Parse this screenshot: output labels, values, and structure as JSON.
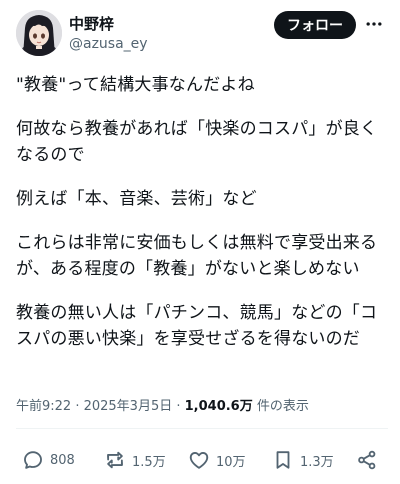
{
  "author": {
    "display_name": "中野梓",
    "handle": "@azusa_ey"
  },
  "follow_button": "フォロー",
  "tweet": {
    "paragraphs": [
      "\"教養\"って結構大事なんだよね",
      "何故なら教養があれば「快楽のコスパ」が良くなるので",
      "例えば「本、音楽、芸術」など",
      "これらは非常に安価もしくは無料で享受出来るが、ある程度の「教養」がないと楽しめない",
      "教養の無い人は「パチンコ、競馬」などの「コスパの悪い快楽」を享受せざるを得ないのだ"
    ]
  },
  "meta": {
    "timestamp": "午前9:22 · 2025年3月5日 · ",
    "views": "1,040.6万",
    "views_suffix": " 件の表示"
  },
  "actions": {
    "replies": "808",
    "reposts": "1.5万",
    "likes": "10万",
    "bookmarks": "1.3万"
  }
}
